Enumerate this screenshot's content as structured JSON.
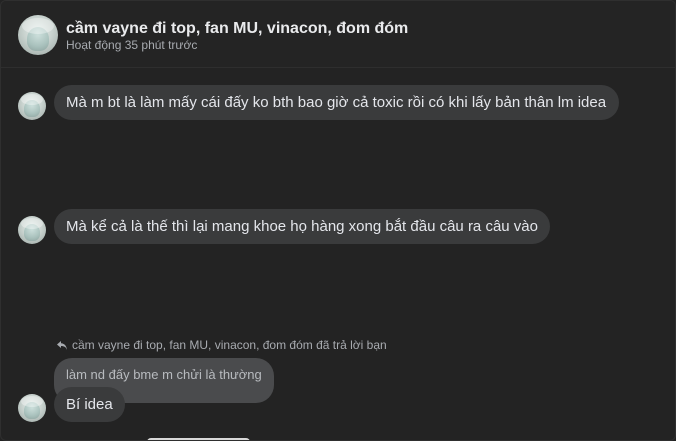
{
  "header": {
    "title": "cầm vayne đi top, fan MU, vinacon, đom đóm",
    "status": "Hoạt động 35 phút trước"
  },
  "messages": [
    {
      "text": "Mà m bt là làm mấy cái đấy ko bth bao giờ cả toxic rồi có khi lấy bản thân lm idea"
    },
    {
      "text": "Mà kể cả là thế thì lại mang khoe họ hàng xong bắt đầu câu ra câu vào"
    }
  ],
  "reply": {
    "context": "cầm vayne đi top, fan MU, vinacon, đom đóm đã trả lời bạn",
    "quoted_text": "làm nd đấy bme m chửi là thường",
    "text": "Bí idea"
  },
  "colors": {
    "background": "#232323",
    "bubble": "#3a3b3c",
    "quoted_bubble": "#4a4b4d",
    "text": "#e4e6eb",
    "muted_text": "#a8abb0"
  },
  "icons": {
    "reply": "reply-arrow-icon"
  }
}
